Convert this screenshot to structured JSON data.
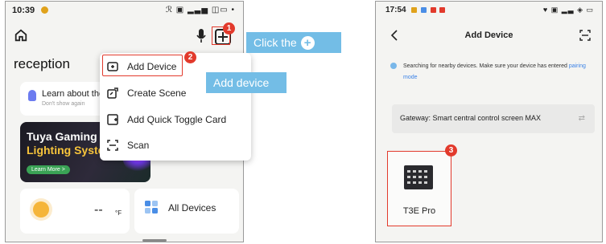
{
  "left_screen": {
    "status_bar": {
      "time": "10:39",
      "right": "ℛ ▣ ▂▃▅ ◫▭ •"
    },
    "room_title": "reception",
    "learn_card": {
      "title": "Learn about the",
      "subtitle": "Don't show again"
    },
    "banner": {
      "line1": "Tuya Gaming",
      "line2": "Lighting Syste",
      "button": "Learn More >"
    },
    "weather": {
      "temperature": "--",
      "unit": "°F"
    },
    "all_devices_label": "All Devices",
    "menu": {
      "items": [
        {
          "label": "Add Device",
          "icon": "add-device-icon"
        },
        {
          "label": "Create Scene",
          "icon": "create-scene-icon"
        },
        {
          "label": "Add Quick Toggle Card",
          "icon": "quick-toggle-icon"
        },
        {
          "label": "Scan",
          "icon": "scan-icon"
        }
      ]
    },
    "annotations": {
      "badge1": "1",
      "badge2": "2",
      "callout1": "Click the",
      "callout1_symbol": "+",
      "callout2": "Add device"
    }
  },
  "right_screen": {
    "status_bar": {
      "time": "17:54",
      "right": "♥ ▣ ▂▃ ◈ ▭"
    },
    "title": "Add Device",
    "search_text": "Searching for nearby devices. Make sure your device has entered",
    "search_link": "pairing mode",
    "gateway_label": "Gateway: Smart central control screen MAX",
    "gateway_arrows": "⇄",
    "device_name": "T3E Pro",
    "badge3": "3"
  },
  "colors": {
    "accent_red": "#e23a2c",
    "callout_blue": "#73bde6",
    "link_blue": "#3b82e6"
  }
}
